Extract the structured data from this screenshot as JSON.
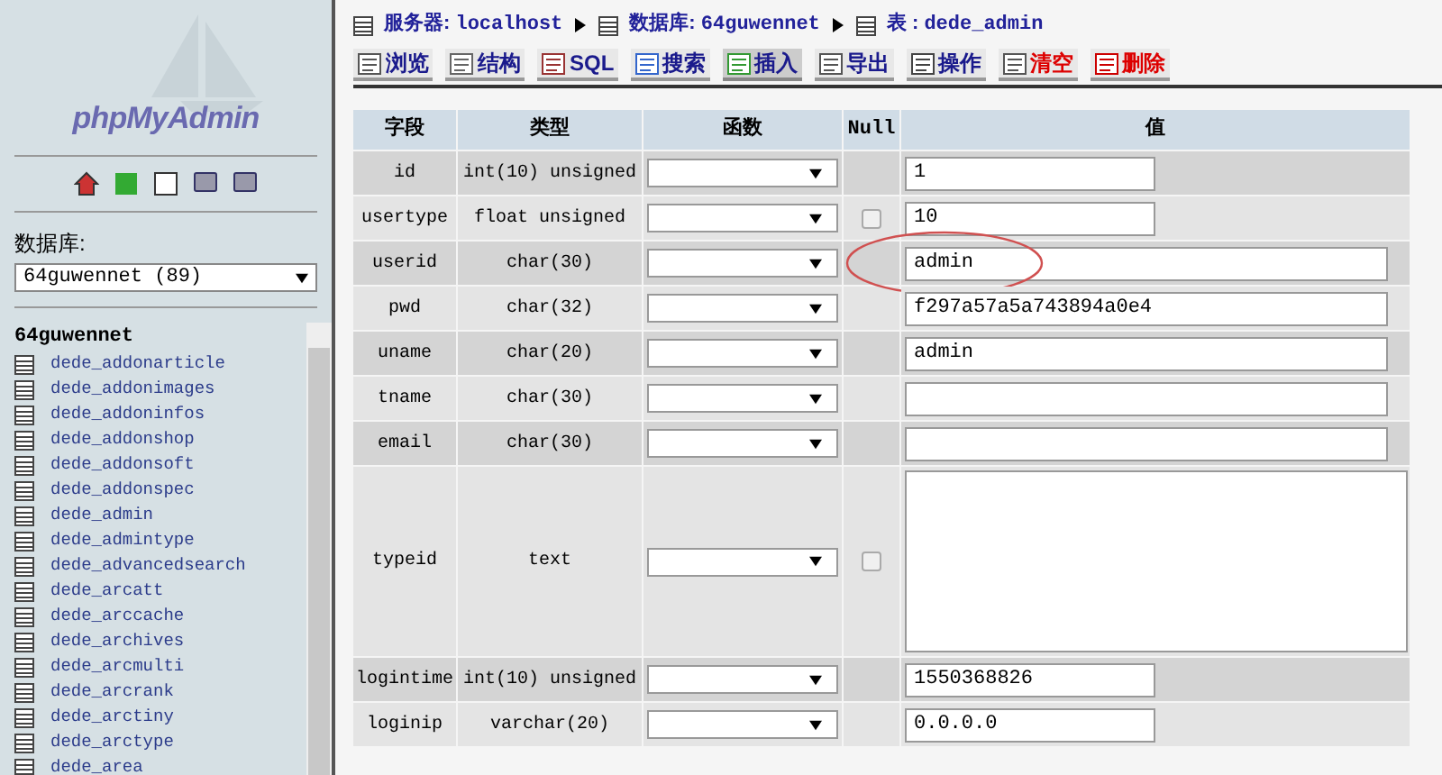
{
  "sidebar": {
    "logo": "phpMyAdmin",
    "db_label": "数据库:",
    "db_select": "64guwennet (89)",
    "db_name": "64guwennet",
    "tables": [
      "dede_addonarticle",
      "dede_addonimages",
      "dede_addoninfos",
      "dede_addonshop",
      "dede_addonsoft",
      "dede_addonspec",
      "dede_admin",
      "dede_admintype",
      "dede_advancedsearch",
      "dede_arcatt",
      "dede_arccache",
      "dede_archives",
      "dede_arcmulti",
      "dede_arcrank",
      "dede_arctiny",
      "dede_arctype",
      "dede_area"
    ]
  },
  "breadcrumb": [
    {
      "label": "服务器:",
      "value": "localhost"
    },
    {
      "label": "数据库:",
      "value": "64guwennet"
    },
    {
      "label": "表 :",
      "value": "dede_admin"
    }
  ],
  "tabs": [
    {
      "label": "浏览",
      "selected": false,
      "danger": false
    },
    {
      "label": "结构",
      "selected": false,
      "danger": false
    },
    {
      "label": "SQL",
      "selected": false,
      "danger": false
    },
    {
      "label": "搜索",
      "selected": false,
      "danger": false
    },
    {
      "label": "插入",
      "selected": true,
      "danger": false
    },
    {
      "label": "导出",
      "selected": false,
      "danger": false
    },
    {
      "label": "操作",
      "selected": false,
      "danger": false
    },
    {
      "label": "清空",
      "selected": false,
      "danger": true
    },
    {
      "label": "删除",
      "selected": false,
      "danger": true
    }
  ],
  "table": {
    "columns": [
      "字段",
      "类型",
      "函数",
      "Null",
      "值"
    ],
    "rows": [
      {
        "field": "id",
        "type": "int(10) unsigned",
        "nullable": false,
        "kind": "short",
        "value": "1",
        "highlighted": false
      },
      {
        "field": "usertype",
        "type": "float unsigned",
        "nullable": true,
        "kind": "short",
        "value": "10",
        "highlighted": false
      },
      {
        "field": "userid",
        "type": "char(30)",
        "nullable": false,
        "kind": "wide",
        "value": "admin",
        "highlighted": true
      },
      {
        "field": "pwd",
        "type": "char(32)",
        "nullable": false,
        "kind": "wide",
        "value": "f297a57a5a743894a0e4",
        "highlighted": false
      },
      {
        "field": "uname",
        "type": "char(20)",
        "nullable": false,
        "kind": "wide",
        "value": "admin",
        "highlighted": false
      },
      {
        "field": "tname",
        "type": "char(30)",
        "nullable": false,
        "kind": "wide",
        "highlighted": false
      },
      {
        "field": "email",
        "type": "char(30)",
        "nullable": false,
        "kind": "wide",
        "highlighted": false
      },
      {
        "field": "typeid",
        "type": "text",
        "nullable": true,
        "kind": "textarea",
        "highlighted": false
      },
      {
        "field": "logintime",
        "type": "int(10) unsigned",
        "nullable": false,
        "kind": "short",
        "value": "1550368826",
        "highlighted": false
      },
      {
        "field": "loginip",
        "type": "varchar(20)",
        "nullable": false,
        "kind": "short",
        "value": "0.0.0.0",
        "highlighted": false
      }
    ]
  }
}
